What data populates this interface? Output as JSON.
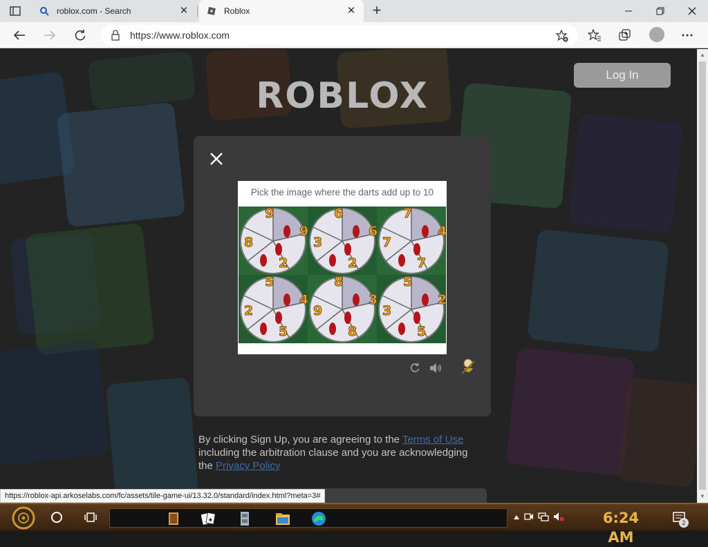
{
  "browser": {
    "tabs": [
      {
        "title": "roblox.com - Search",
        "icon": "search-icon"
      },
      {
        "title": "Roblox",
        "icon": "roblox-favicon",
        "active": true
      }
    ],
    "address": "https://www.roblox.com",
    "status_url": "https://roblox-api.arkoselabs.com/fc/assets/tile-game-ui/13.32.0/standard/index.html?meta=3#"
  },
  "page": {
    "logo_text": "ROBLOX",
    "login_label": "Log In",
    "captcha": {
      "prompt": "Pick the image where the darts add up to 10",
      "tiles": [
        {
          "numbers": [
            "9",
            "8",
            "9",
            "2"
          ]
        },
        {
          "numbers": [
            "6",
            "3",
            "6",
            "2"
          ]
        },
        {
          "numbers": [
            "7",
            "7",
            "4",
            "7"
          ]
        },
        {
          "numbers": [
            "5",
            "2",
            "4",
            "5"
          ]
        },
        {
          "numbers": [
            "8",
            "9",
            "3",
            "8"
          ]
        },
        {
          "numbers": [
            "5",
            "3",
            "2",
            "5"
          ]
        }
      ]
    },
    "terms": {
      "prefix": "By clicking Sign Up, you are agreeing to the ",
      "terms_link": "Terms of Use",
      "middle": " including the arbitration clause and you are acknowledging the ",
      "privacy_link": "Privacy Policy"
    }
  },
  "taskbar": {
    "clock": "6:24 AM",
    "notification_count": "2"
  },
  "colors": {
    "accent_link": "#3d6ea8",
    "clock": "#e8b54a",
    "modal_bg": "#3a3a3a"
  }
}
